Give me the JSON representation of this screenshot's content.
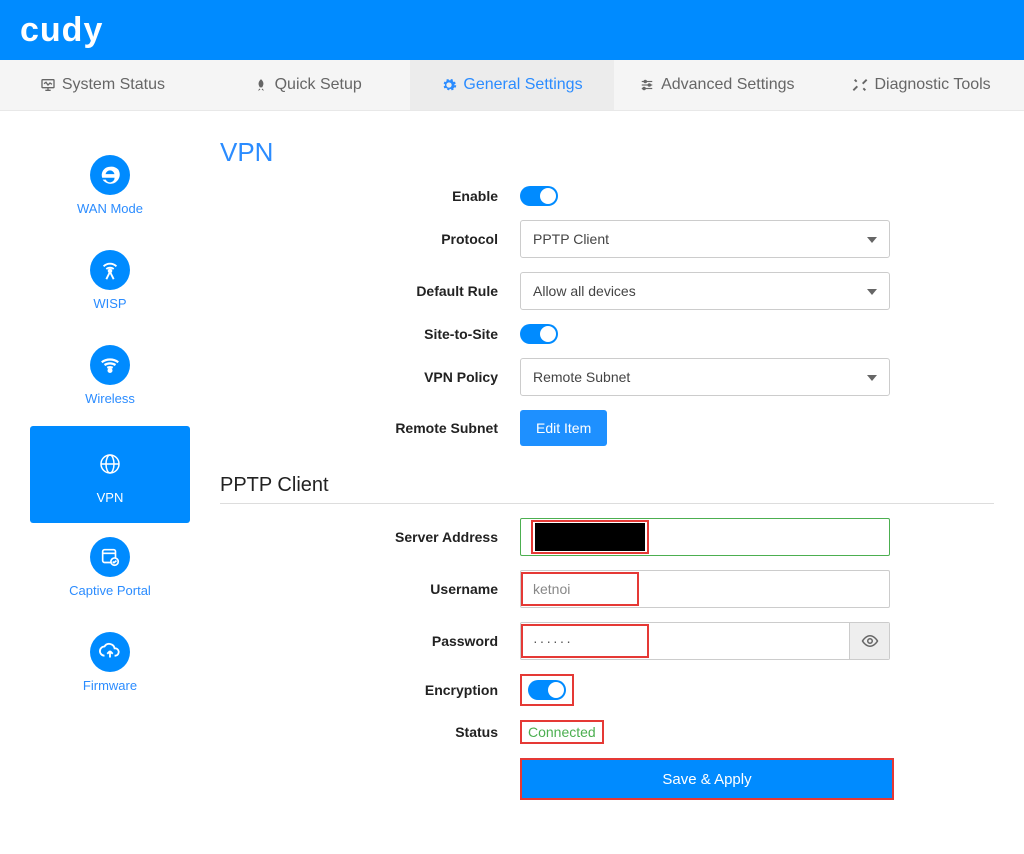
{
  "brand": "cudy",
  "tabs": {
    "system_status": "System Status",
    "quick_setup": "Quick Setup",
    "general_settings": "General Settings",
    "advanced_settings": "Advanced Settings",
    "diagnostic_tools": "Diagnostic Tools"
  },
  "sidebar": {
    "wan_mode": "WAN Mode",
    "wisp": "WISP",
    "wireless": "Wireless",
    "vpn": "VPN",
    "captive_portal": "Captive Portal",
    "firmware": "Firmware"
  },
  "vpn": {
    "title": "VPN",
    "labels": {
      "enable": "Enable",
      "protocol": "Protocol",
      "default_rule": "Default Rule",
      "site_to_site": "Site-to-Site",
      "vpn_policy": "VPN Policy",
      "remote_subnet": "Remote Subnet"
    },
    "values": {
      "protocol": "PPTP Client",
      "default_rule": "Allow all devices",
      "vpn_policy": "Remote Subnet",
      "edit_item": "Edit Item"
    }
  },
  "pptp": {
    "title": "PPTP Client",
    "labels": {
      "server_address": "Server Address",
      "username": "Username",
      "password": "Password",
      "encryption": "Encryption",
      "status": "Status"
    },
    "values": {
      "server_address": "",
      "username": "ketnoi",
      "password": "······",
      "status": "Connected"
    }
  },
  "actions": {
    "save_apply": "Save & Apply"
  }
}
